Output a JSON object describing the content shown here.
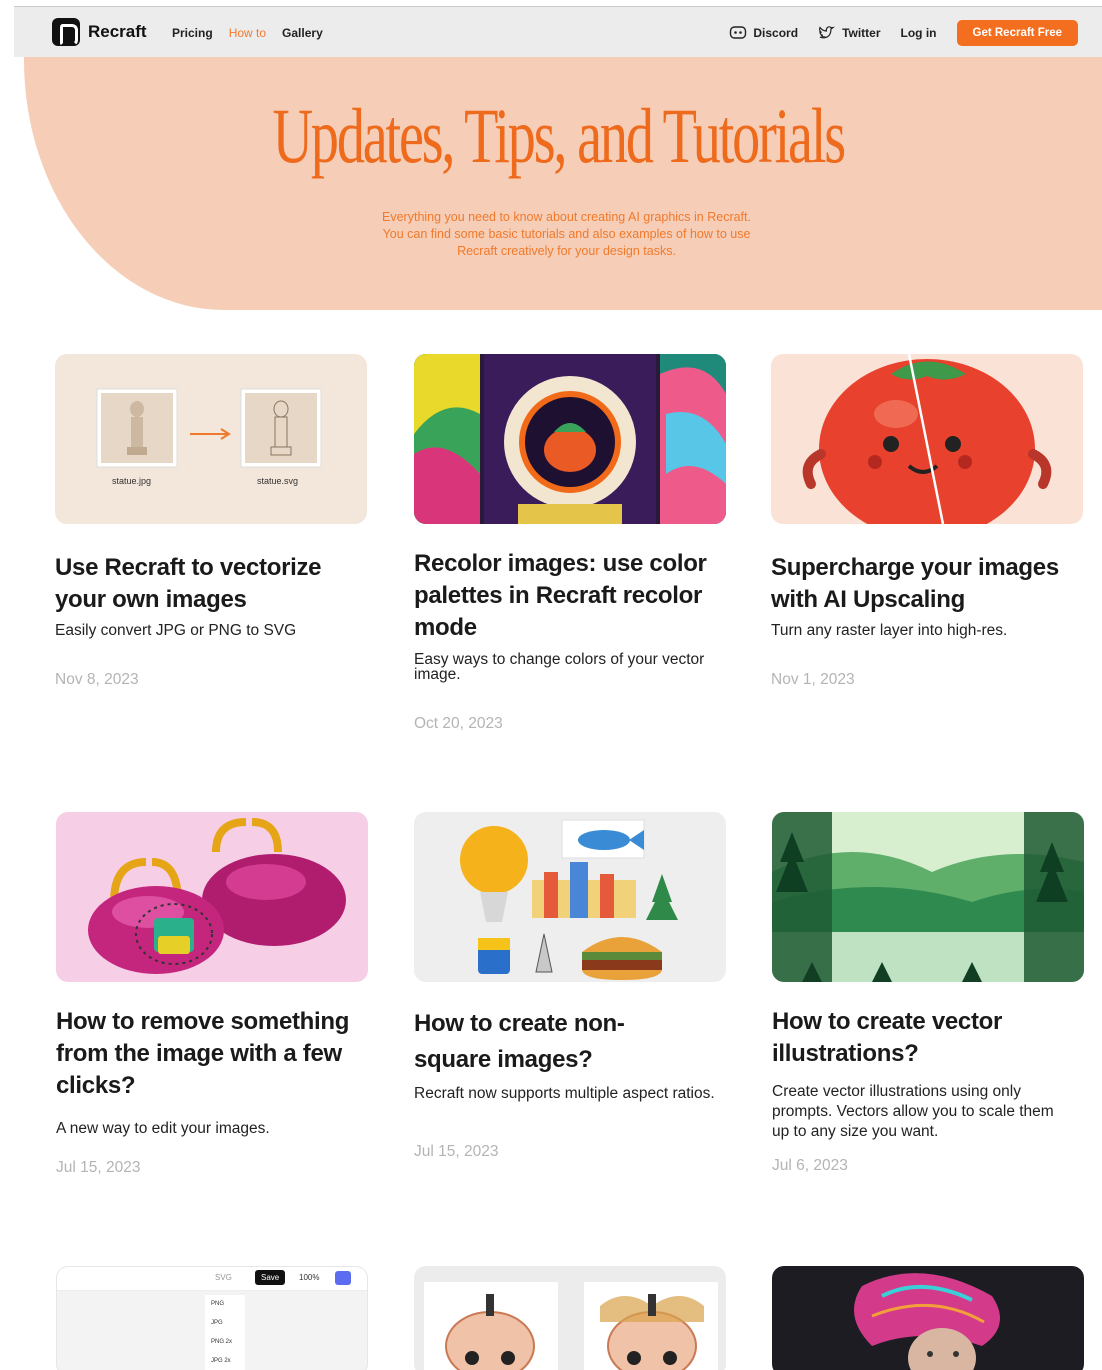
{
  "header": {
    "brand": "Recraft",
    "nav": [
      "Pricing",
      "How to",
      "Gallery"
    ],
    "active_nav": "How to",
    "discord": "Discord",
    "twitter": "Twitter",
    "login": "Log in",
    "cta": "Get Recraft Free"
  },
  "hero": {
    "title": "Updates, Tips, and Tutorials",
    "subtitle_line1": "Everything you need to know about creating AI graphics in Recraft.",
    "subtitle_line2": "You can find some basic tutorials and also examples of how to use",
    "subtitle_line3": "Recraft creatively for your design tasks."
  },
  "cards": [
    {
      "title": "Use Recraft to vectorize your own images",
      "desc": "Easily convert JPG or PNG to SVG",
      "date": "Nov 8, 2023",
      "label_a": "statue.jpg",
      "label_b": "statue.svg"
    },
    {
      "title": "Recolor images: use color palettes in Recraft recolor mode",
      "desc": "Easy ways to change colors of your vector image.",
      "date": "Oct 20, 2023"
    },
    {
      "title": "Supercharge your images with AI Upscaling",
      "desc": "Turn any raster layer into high-res.",
      "date": "Nov 1, 2023"
    },
    {
      "title": "How to remove something from the image with a few clicks?",
      "desc": "A new way to edit your images.",
      "date": "Jul 15, 2023"
    },
    {
      "title": "How to create non-square images?",
      "desc": "Recraft now supports multiple aspect ratios.",
      "date": "Jul 15, 2023"
    },
    {
      "title": "How to create vector illustrations?",
      "desc": "Create vector illustrations using only prompts. Vectors allow you to scale them up to any size you want.",
      "date": "Jul 6, 2023"
    }
  ],
  "export_menu": {
    "format": "SVG",
    "save": "Save",
    "zoom": "100%",
    "options": [
      "PNG",
      "JPG",
      "PNG 2x",
      "JPG 2x"
    ]
  },
  "colors": {
    "accent": "#f36f1f",
    "hero_bg": "#f6cdb6",
    "title_orange": "#ee6a1c"
  }
}
